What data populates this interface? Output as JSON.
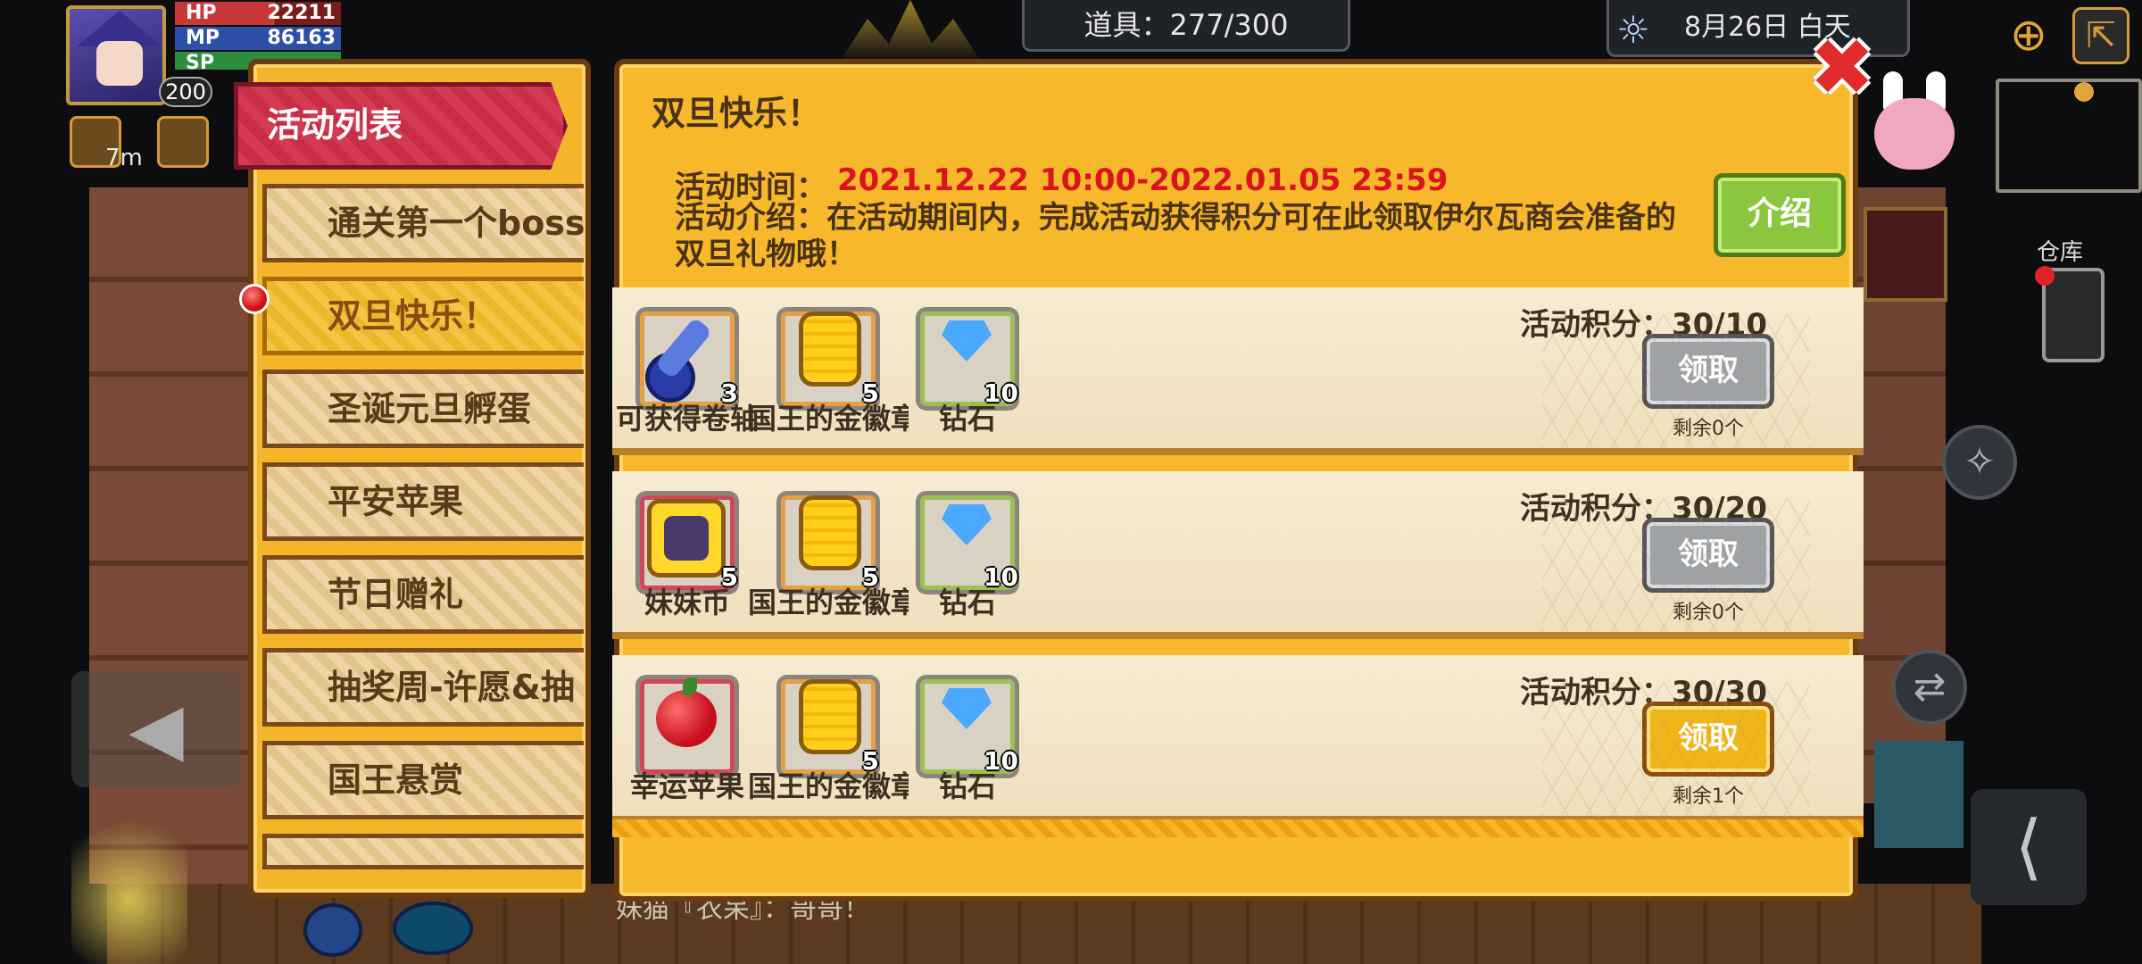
{
  "hud": {
    "hp_label": "HP",
    "hp_value": "22211",
    "mp_label": "MP",
    "mp_value": "86163",
    "sp_label": "SP",
    "level": "200",
    "buff_time": "7m",
    "items_count": "道具：277/300",
    "date": "8月26日 白天",
    "storage_label": "仓库"
  },
  "sidebar": {
    "header": "活动列表",
    "items": [
      {
        "label": "通关第一个boss"
      },
      {
        "label": "双旦快乐！"
      },
      {
        "label": "圣诞元旦孵蛋"
      },
      {
        "label": "平安苹果"
      },
      {
        "label": "节日赠礼"
      },
      {
        "label": "抽奖周-许愿&抽"
      },
      {
        "label": "国王悬赏"
      }
    ]
  },
  "event": {
    "title": "双旦快乐！",
    "time_label": "活动时间：",
    "time_value": "2021.12.22 10:00-2022.01.05 23:59",
    "description": "活动介绍：在活动期间内，完成活动获得积分可在此领取伊尔瓦商会准备的双旦礼物哦！",
    "intro_button": "介绍"
  },
  "rewards": [
    {
      "points": "活动积分：30/10",
      "claim_label": "领取",
      "remaining": "剩余0个",
      "items": [
        {
          "name": "可获得卷轴",
          "qty": "3",
          "icon": "scroll-icon"
        },
        {
          "name": "国王的金徽章",
          "qty": "5",
          "icon": "gold-badge-icon"
        },
        {
          "name": "钻石",
          "qty": "10",
          "icon": "diamond-icon"
        }
      ]
    },
    {
      "points": "活动积分：30/20",
      "claim_label": "领取",
      "remaining": "剩余0个",
      "items": [
        {
          "name": "妹妹币",
          "qty": "5",
          "icon": "sister-coin-icon"
        },
        {
          "name": "国王的金徽章",
          "qty": "5",
          "icon": "gold-badge-icon"
        },
        {
          "name": "钻石",
          "qty": "10",
          "icon": "diamond-icon"
        }
      ]
    },
    {
      "points": "活动积分：30/30",
      "claim_label": "领取",
      "remaining": "剩余1个",
      "items": [
        {
          "name": "幸运苹果",
          "qty": "",
          "icon": "apple-icon"
        },
        {
          "name": "国王的金徽章",
          "qty": "5",
          "icon": "gold-badge-icon"
        },
        {
          "name": "钻石",
          "qty": "10",
          "icon": "diamond-icon"
        }
      ]
    }
  ],
  "background": {
    "chat_text": "妹猫『衣呆』：哥哥！"
  },
  "colors": {
    "panel": "#f7b82b",
    "sidebar_header": "#d43a52",
    "event_time": "#d9141e",
    "claim_active": "#f0b519",
    "claim_disabled": "#9ea2a6"
  }
}
